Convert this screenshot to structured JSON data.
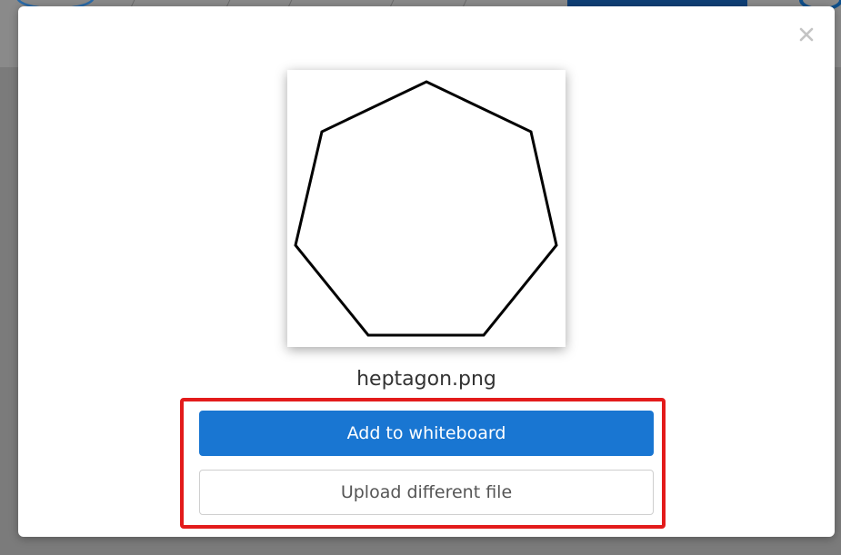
{
  "dialog": {
    "close_icon": "close-icon",
    "preview": {
      "shape": "heptagon",
      "stroke_color": "#000000",
      "background_color": "#ffffff"
    },
    "file_name": "heptagon.png",
    "primary_button": {
      "label": "Add to whiteboard",
      "color": "#1976d2"
    },
    "secondary_button": {
      "label": "Upload different file"
    },
    "highlight_color": "#e31b1b"
  }
}
